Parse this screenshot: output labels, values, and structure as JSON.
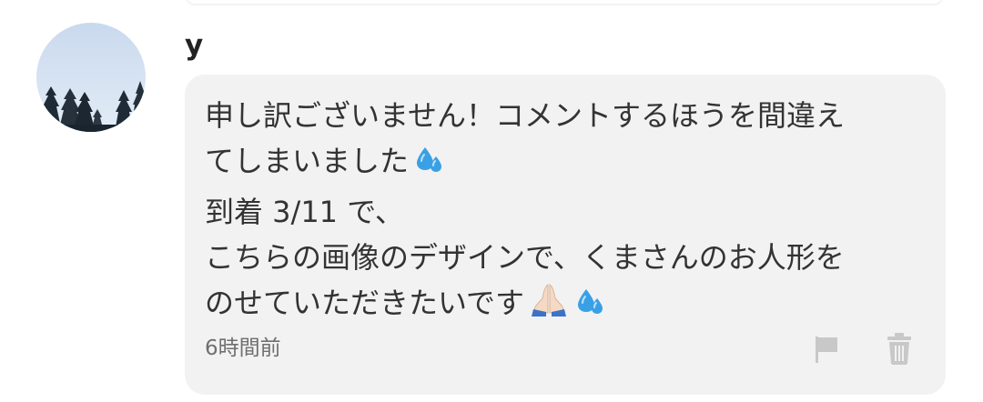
{
  "comment": {
    "username": "y",
    "message_lines": [
      "申し訳ございません！コメントするほうを間違え",
      "てしまいました",
      "到着 3/11 で、",
      "こちらの画像のデザインで、くまさんのお人形を",
      "のせていただきたいです"
    ],
    "timestamp": "6時間前",
    "icons": {
      "sweat": "sweat-droplets-icon",
      "pray": "folded-hands-icon",
      "report": "flag-icon",
      "delete": "trash-icon"
    }
  },
  "colors": {
    "bubble": "#f2f2f2",
    "text": "#333333",
    "muted": "#6f6f6f",
    "icon": "#c8c8c8",
    "emoji_blue": "#3aa0e6"
  }
}
